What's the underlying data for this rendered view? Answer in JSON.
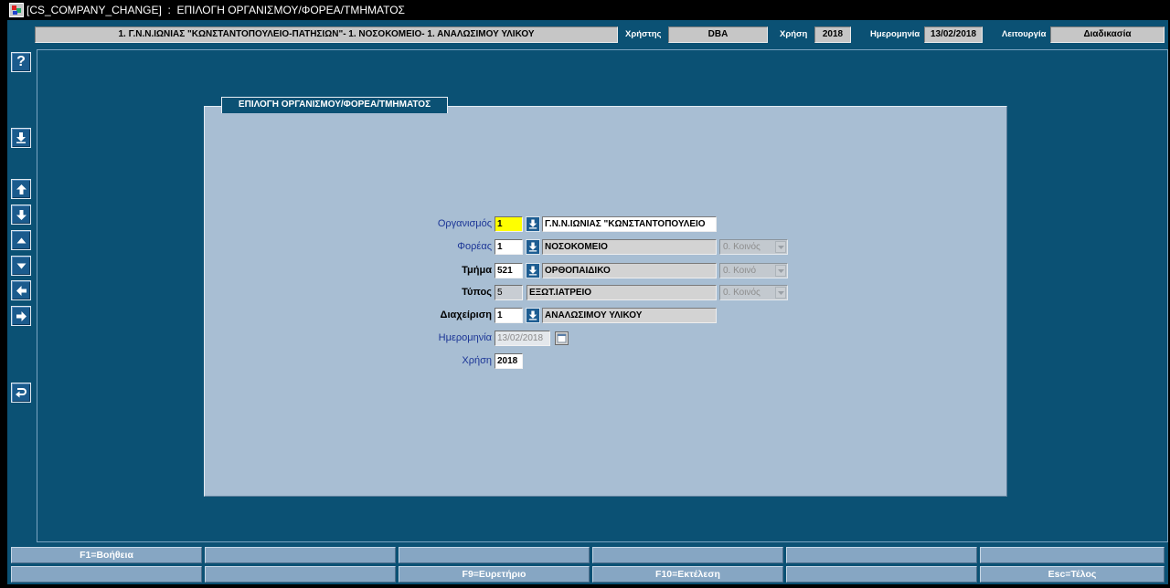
{
  "window": {
    "title": "[CS_COMPANY_CHANGE]  :  ΕΠΙΛΟΓΗ ΟΡΓΑΝΙΣΜΟΥ/ΦΟΡΕΑ/ΤΜΗΜΑΤΟΣ",
    "icon": "app-icon"
  },
  "header": {
    "context": "1. Γ.Ν.Ν.ΙΩΝΙΑΣ \"ΚΩΝΣΤΑΝΤΟΠΟΥΛΕΙΟ-ΠΑΤΗΣΙΩΝ\"- 1. ΝΟΣΟΚΟΜΕΙΟ- 1. ΑΝΑΛΩΣΙΜΟΥ ΥΛΙΚΟΥ",
    "user": {
      "label": "Χρήστης",
      "value": "DBA"
    },
    "year": {
      "label": "Χρήση",
      "value": "2018"
    },
    "date": {
      "label": "Ημερομηνία",
      "value": "13/02/2018"
    },
    "function": {
      "label": "Λειτουργία",
      "value": "Διαδικασία"
    }
  },
  "toolbar": {
    "help_glyph": "?",
    "icons": [
      "help-icon",
      "list-of-values-icon",
      "up-arrow-icon",
      "down-arrow-icon",
      "triangle-up-icon",
      "triangle-down-icon",
      "left-arrow-icon",
      "right-arrow-icon",
      "undo-icon"
    ]
  },
  "panel": {
    "title": "ΕΠΙΛΟΓΗ ΟΡΓΑΝΙΣΜΟΥ/ΦΟΡΕΑ/ΤΜΗΜΑΤΟΣ",
    "organismos": {
      "label": "Οργανισμός",
      "code": "1",
      "name": "Γ.Ν.Ν.ΙΩΝΙΑΣ \"ΚΩΝΣΤΑΝΤΟΠΟΥΛΕΙΟ"
    },
    "foreas": {
      "label": "Φορέας",
      "code": "1",
      "name": "ΝΟΣΟΚΟΜΕΙΟ",
      "type": "0. Κοινός"
    },
    "tmima": {
      "label": "Τμήμα",
      "code": "521",
      "name": "ΟΡΘΟΠΑΙΔΙΚΟ",
      "type": "0. Κοινό"
    },
    "typos": {
      "label": "Τύπος",
      "code": "5",
      "name": "ΕΞΩΤ.ΙΑΤΡΕΙΟ",
      "type": "0. Κοινός"
    },
    "diaxeirisi": {
      "label": "Διαχείριση",
      "code": "1",
      "name": "ΑΝΑΛΩΣΙΜΟΥ ΥΛΙΚΟΥ"
    },
    "imerominia": {
      "label": "Ημερομηνία",
      "value": "13/02/2018"
    },
    "xrisi": {
      "label": "Χρήση",
      "value": "2018"
    }
  },
  "function_keys": {
    "row1": [
      "F1=Βοήθεια",
      "",
      "",
      "",
      "",
      ""
    ],
    "row2": [
      "",
      "",
      "F9=Ευρετήριο",
      "F10=Εκτέλεση",
      "",
      "Esc=Τέλος"
    ]
  },
  "colors": {
    "window_bg": "#0b5174",
    "panel_bg": "#a8bed3",
    "label_blue": "#1b3596",
    "focused_field": "#ffff00",
    "function_key_bg": "#86a6c3"
  }
}
